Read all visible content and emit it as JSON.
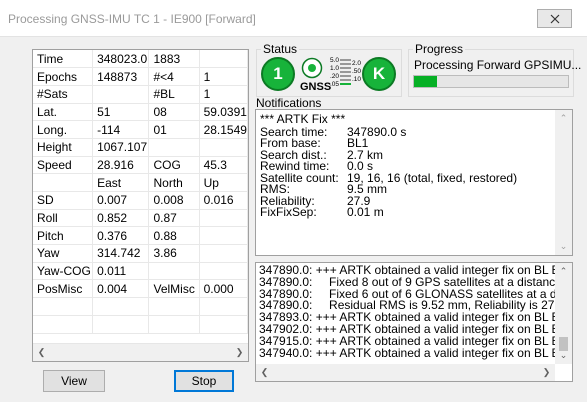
{
  "window": {
    "title": "Processing GNSS-IMU TC 1 - IE900 [Forward]"
  },
  "grid": {
    "rows": [
      [
        "Time",
        "348023.0",
        "1883",
        ""
      ],
      [
        "Epochs",
        "148873",
        "#<4",
        "1"
      ],
      [
        "#Sats",
        "",
        "#BL",
        "1"
      ],
      [
        "Lat.",
        "51",
        "08",
        "59.0391"
      ],
      [
        "Long.",
        "-114",
        "01",
        "28.1549"
      ],
      [
        "Height",
        "1067.107",
        "",
        ""
      ],
      [
        "Speed",
        "28.916",
        "COG",
        "45.3"
      ],
      [
        "",
        "East",
        "North",
        "Up"
      ],
      [
        "SD",
        "0.007",
        "0.008",
        "0.016"
      ],
      [
        "Roll",
        "0.852",
        "0.87",
        ""
      ],
      [
        "Pitch",
        "0.376",
        "0.88",
        ""
      ],
      [
        "Yaw",
        "314.742",
        "3.86",
        ""
      ],
      [
        "Yaw-COG",
        "0.011",
        "",
        ""
      ],
      [
        "PosMisc",
        "0.004",
        "VelMisc",
        "0.000"
      ],
      [
        "",
        "",
        "",
        ""
      ],
      [
        "",
        "",
        "",
        ""
      ]
    ]
  },
  "buttons": {
    "view": "View",
    "stop": "Stop"
  },
  "status": {
    "label": "Status",
    "badge_left": "1",
    "gnss_label": "GNSS",
    "scale_left": [
      "5.0",
      "1.0",
      ".20",
      ".05"
    ],
    "scale_right": [
      "2.0",
      ".50",
      ".10"
    ],
    "badge_right": "K",
    "badge_color": "#17b33a"
  },
  "progress": {
    "label": "Progress",
    "text": "Processing Forward GPSIMU...",
    "value_fraction": 0.15,
    "fill_color": "#06b025"
  },
  "notifications": {
    "label": "Notifications",
    "heading": "*** ARTK Fix ***",
    "items": [
      {
        "key": "Search time:",
        "value": "347890.0 s"
      },
      {
        "key": "From base:",
        "value": "BL1"
      },
      {
        "key": "Search dist.:",
        "value": "2.7 km"
      },
      {
        "key": "Rewind time:",
        "value": "0.0 s"
      },
      {
        "key": "Satellite count:",
        "value": "19, 16, 16  (total, fixed, restored)"
      },
      {
        "key": "RMS:",
        "value": "9.5 mm"
      },
      {
        "key": "Reliability:",
        "value": "27.9"
      },
      {
        "key": "FixFixSep:",
        "value": "0.01 m"
      }
    ]
  },
  "log": {
    "lines": [
      "347890.0: +++ ARTK obtained a valid integer fix on BL BL1",
      "347890.0:     Fixed 8 out of 9 GPS satellites at a distance of 2.7",
      "347890.0:     Fixed 6 out of 6 GLONASS satellites at a distance",
      "347890.0:     Residual RMS is 9.52 mm, Reliability is 27.9, Fix/I",
      "347893.0: +++ ARTK obtained a valid integer fix on BL BL1",
      "347902.0: +++ ARTK obtained a valid integer fix on BL BL1",
      "347915.0: +++ ARTK obtained a valid integer fix on BL BL1",
      "347940.0: +++ ARTK obtained a valid integer fix on BL BL1"
    ]
  }
}
